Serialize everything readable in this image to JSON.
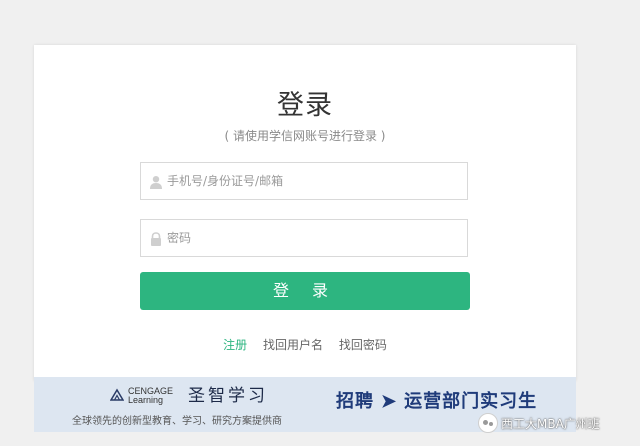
{
  "login": {
    "title": "登录",
    "subtitle": "( 请使用学信网账号进行登录 )",
    "username_placeholder": "手机号/身份证号/邮箱",
    "password_placeholder": "密码",
    "submit_label": "登 录",
    "links": {
      "register": "注册",
      "find_username": "找回用户名",
      "find_password": "找回密码"
    }
  },
  "banner": {
    "brand_line1": "CENGAGE",
    "brand_line2": "Learning",
    "brand_cn": "圣智学习",
    "tagline": "全球领先的创新型教育、学习、研究方案提供商",
    "recruit_prefix": "招聘",
    "arrow": "➤",
    "recruit_text": "运营部门实习生"
  },
  "watermark": {
    "text": "西工大MBA广州班"
  },
  "colors": {
    "accent": "#2db580",
    "banner_bg": "#dde6f1",
    "recruit": "#1f3b7a"
  },
  "icons": {
    "username": "user-icon",
    "password": "lock-icon",
    "brand": "cengage-logo-icon",
    "watermark": "wechat-logo-icon"
  }
}
